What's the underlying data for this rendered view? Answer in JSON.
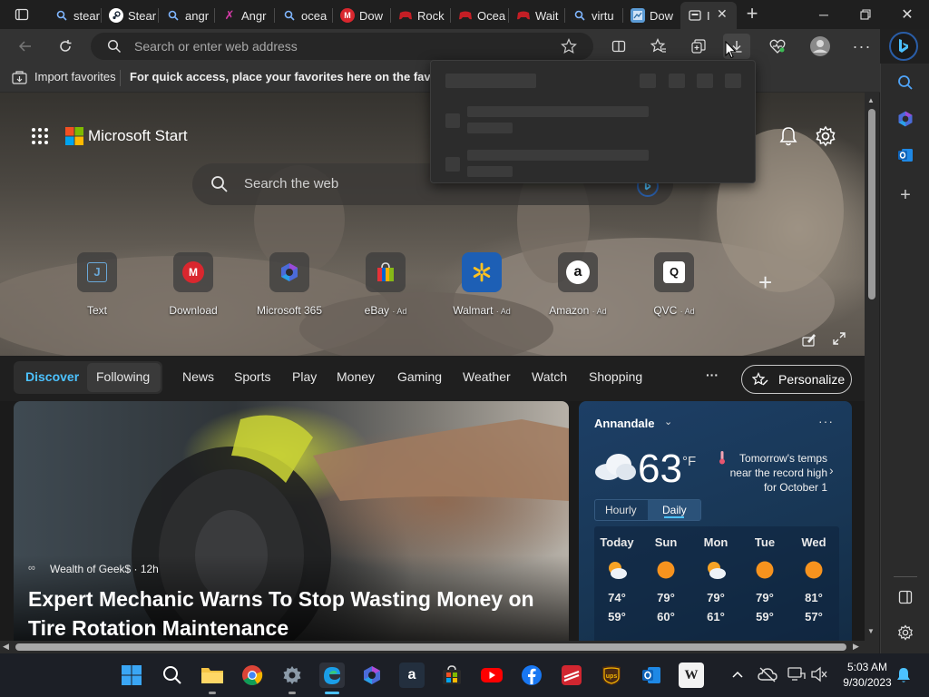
{
  "tabs": [
    {
      "label": "stear",
      "icon": "search-icon"
    },
    {
      "label": "Stear",
      "icon": "steam-icon"
    },
    {
      "label": "angr",
      "icon": "search-icon"
    },
    {
      "label": "Angr",
      "icon": "bird-icon"
    },
    {
      "label": "ocea",
      "icon": "search-icon"
    },
    {
      "label": "Dow",
      "icon": "mega-icon"
    },
    {
      "label": "Rock",
      "icon": "gamepad-icon"
    },
    {
      "label": "Ocea",
      "icon": "gamepad-icon"
    },
    {
      "label": "Wait",
      "icon": "gamepad-icon"
    },
    {
      "label": "virtu",
      "icon": "search-icon"
    },
    {
      "label": "Dow",
      "icon": "page-icon"
    },
    {
      "label": "I",
      "icon": "newtab-icon",
      "active": true
    }
  ],
  "toolbar": {
    "address_placeholder": "Search or enter web address"
  },
  "favorites_bar": {
    "import_label": "Import favorites",
    "hint": "For quick access, place your favorites here on the favorites ba"
  },
  "start": {
    "logo_text": "Microsoft Start",
    "search_placeholder": "Search the web"
  },
  "quick_links": [
    {
      "label": "Text",
      "ad": "",
      "icon": "text-icon"
    },
    {
      "label": "Download",
      "ad": "",
      "icon": "mega-icon"
    },
    {
      "label": "Microsoft 365",
      "ad": "",
      "icon": "m365-icon"
    },
    {
      "label": "eBay",
      "ad": "· Ad",
      "icon": "shopping-bag-icon"
    },
    {
      "label": "Walmart",
      "ad": "· Ad",
      "icon": "walmart-icon"
    },
    {
      "label": "Amazon",
      "ad": "· Ad",
      "icon": "amazon-icon"
    },
    {
      "label": "QVC",
      "ad": "· Ad",
      "icon": "qvc-icon"
    }
  ],
  "nav": {
    "discover": "Discover",
    "following": "Following",
    "items": [
      "News",
      "Sports",
      "Play",
      "Money",
      "Gaming",
      "Weather",
      "Watch",
      "Shopping"
    ],
    "more": "···",
    "personalize": "Personalize"
  },
  "news": {
    "source": "Wealth of Geek$ · 12h",
    "headline": "Expert Mechanic Warns To Stop Wasting Money on Tire Rotation Maintenance"
  },
  "weather": {
    "location": "Annandale",
    "temp": "63",
    "unit": "°F",
    "alert": "Tomorrow's temps near the record high for October 1",
    "tab_hourly": "Hourly",
    "tab_daily": "Daily",
    "forecast": [
      {
        "day": "Today",
        "hi": "74°",
        "lo": "59°",
        "icon": "partly-sunny-icon"
      },
      {
        "day": "Sun",
        "hi": "79°",
        "lo": "60°",
        "icon": "sun-icon"
      },
      {
        "day": "Mon",
        "hi": "79°",
        "lo": "61°",
        "icon": "partly-sunny-icon"
      },
      {
        "day": "Tue",
        "hi": "79°",
        "lo": "59°",
        "icon": "sun-icon"
      },
      {
        "day": "Wed",
        "hi": "81°",
        "lo": "57°",
        "icon": "sun-icon"
      }
    ]
  },
  "taskbar": {
    "time": "5:03 AM",
    "date": "9/30/2023"
  },
  "colors": {
    "accent": "#4cc2ff",
    "brand_red": "#f25022",
    "brand_green": "#7fba00",
    "brand_blue": "#00a4ef",
    "brand_yellow": "#ffb900"
  }
}
